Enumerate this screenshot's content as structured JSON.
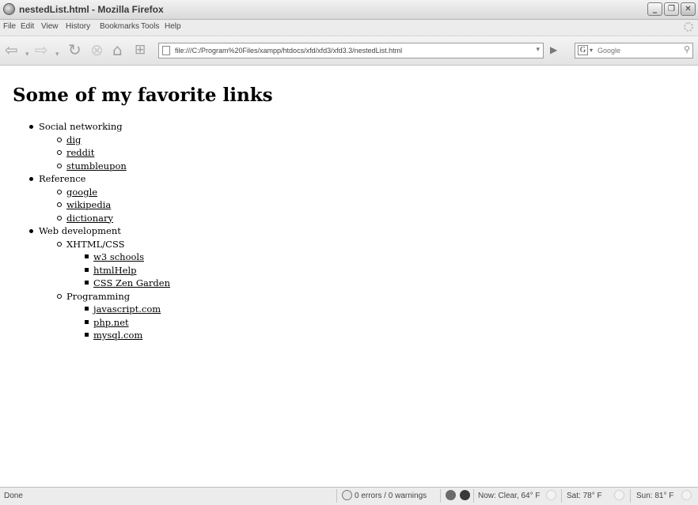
{
  "window": {
    "title": "nestedList.html - Mozilla Firefox"
  },
  "menus": [
    "File",
    "Edit",
    "View",
    "History",
    "Bookmarks",
    "Tools",
    "Help"
  ],
  "nav": {
    "url": "file:///C:/Program%20Files/xampp/htdocs/xfd/xfd3/xfd3.3/nestedList.html",
    "search_engine_glyph": "G",
    "search_placeholder": "Google",
    "icons": [
      "back-arrow-icon",
      "forward-arrow-icon",
      "reload-icon",
      "stop-icon",
      "home-icon",
      "bookmark-add-icon",
      "page-icon",
      "go-arrow-icon",
      "search-magnifier-icon"
    ]
  },
  "page": {
    "heading": "Some of my favorite links",
    "sections": [
      {
        "label": "Social networking",
        "links": [
          "dig",
          "reddit",
          "stumbleupon"
        ]
      },
      {
        "label": "Reference",
        "links": [
          "google",
          "wikipedia",
          "dictionary"
        ]
      },
      {
        "label": "Web development",
        "groups": [
          {
            "label": "XHTML/CSS",
            "links": [
              "w3 schools",
              "htmlHelp",
              "CSS Zen Garden"
            ]
          },
          {
            "label": "Programming",
            "links": [
              "javascript.com",
              "php.net",
              "mysql.com"
            ]
          }
        ]
      }
    ]
  },
  "status": {
    "done": "Done",
    "errors": "0 errors / 0 warnings",
    "now": "Now: Clear, 64° F",
    "sat": "Sat: 78° F",
    "sun": "Sun: 81° F"
  }
}
